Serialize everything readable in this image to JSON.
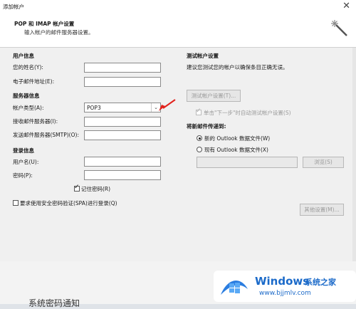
{
  "window": {
    "title": "添加帐户",
    "close_glyph": "✕"
  },
  "header": {
    "title": "POP 和 IMAP 帐户设置",
    "subtitle": "输入帐户的邮件服务器设置。"
  },
  "user_info": {
    "heading": "用户信息",
    "name_label": "您的姓名(Y):",
    "email_label": "电子邮件地址(E):",
    "name_value": "",
    "email_value": ""
  },
  "server_info": {
    "heading": "服务器信息",
    "account_type_label": "帐户类型(A):",
    "account_type_value": "POP3",
    "incoming_label": "接收邮件服务器(I):",
    "outgoing_label": "发送邮件服务器(SMTP)(O):"
  },
  "login_info": {
    "heading": "登录信息",
    "username_label": "用户名(U):",
    "password_label": "密码(P):",
    "remember_password_label": "记住密码(R)",
    "remember_password_checked": true
  },
  "spa": {
    "label": "要求使用安全密码验证(SPA)进行登录(Q)",
    "checked": false
  },
  "test": {
    "heading": "测试帐户设置",
    "description": "建议您测试您的帐户以确保条目正确无误。",
    "button_label": "测试帐户设置(T)...",
    "auto_test_label": "单击\"下一步\"时自动测试帐户设置(S)",
    "auto_test_checked": true
  },
  "delivery": {
    "heading": "将新邮件传递到:",
    "new_label": "新的 Outlook 数据文件(W)",
    "existing_label": "现有 Outlook 数据文件(X)",
    "browse_label": "浏览(S)",
    "selected": "new"
  },
  "more_settings_label": "其他设置(M)...",
  "background": {
    "partial_text": "系统密码通知"
  },
  "watermark": {
    "brand": "Windows",
    "cn": "系统之家",
    "url": "www.bjjmlv.com"
  },
  "icons": {
    "dropdown": "chevron-down-icon",
    "wizard": "wizard-wand-icon",
    "arrow": "red-arrow-annotation-icon"
  },
  "colors": {
    "arrow": "#e2221c",
    "watermark": "#1b6ac9"
  }
}
